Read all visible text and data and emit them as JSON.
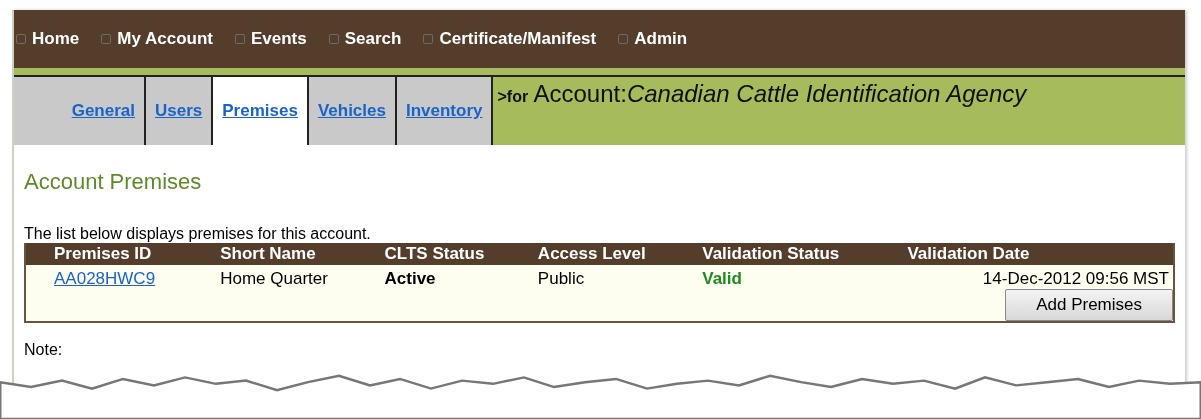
{
  "nav": [
    {
      "label": "Home"
    },
    {
      "label": "My Account"
    },
    {
      "label": "Events"
    },
    {
      "label": "Search"
    },
    {
      "label": "Certificate/Manifest"
    },
    {
      "label": "Admin"
    }
  ],
  "tabs": [
    {
      "label": "General",
      "selected": false
    },
    {
      "label": "Users",
      "selected": false
    },
    {
      "label": "Premises",
      "selected": true
    },
    {
      "label": "Vehicles",
      "selected": false
    },
    {
      "label": "Inventory",
      "selected": false
    }
  ],
  "account": {
    "prefix": ">for",
    "label": "Account:",
    "name": "Canadian Cattle Identification Agency"
  },
  "heading": "Account Premises",
  "intro": "The list below displays premises for this account.",
  "table": {
    "columns": [
      "Premises ID",
      "Short Name",
      "CLTS Status",
      "Access Level",
      "Validation Status",
      "Validation Date"
    ],
    "rows": [
      {
        "id": "AA028HWC9",
        "short_name": "Home Quarter",
        "clts_status": "Active",
        "access_level": "Public",
        "validation_status": "Valid",
        "validation_date": "14-Dec-2012 09:56 MST"
      }
    ]
  },
  "add_button": "Add Premises",
  "note": "Note:"
}
